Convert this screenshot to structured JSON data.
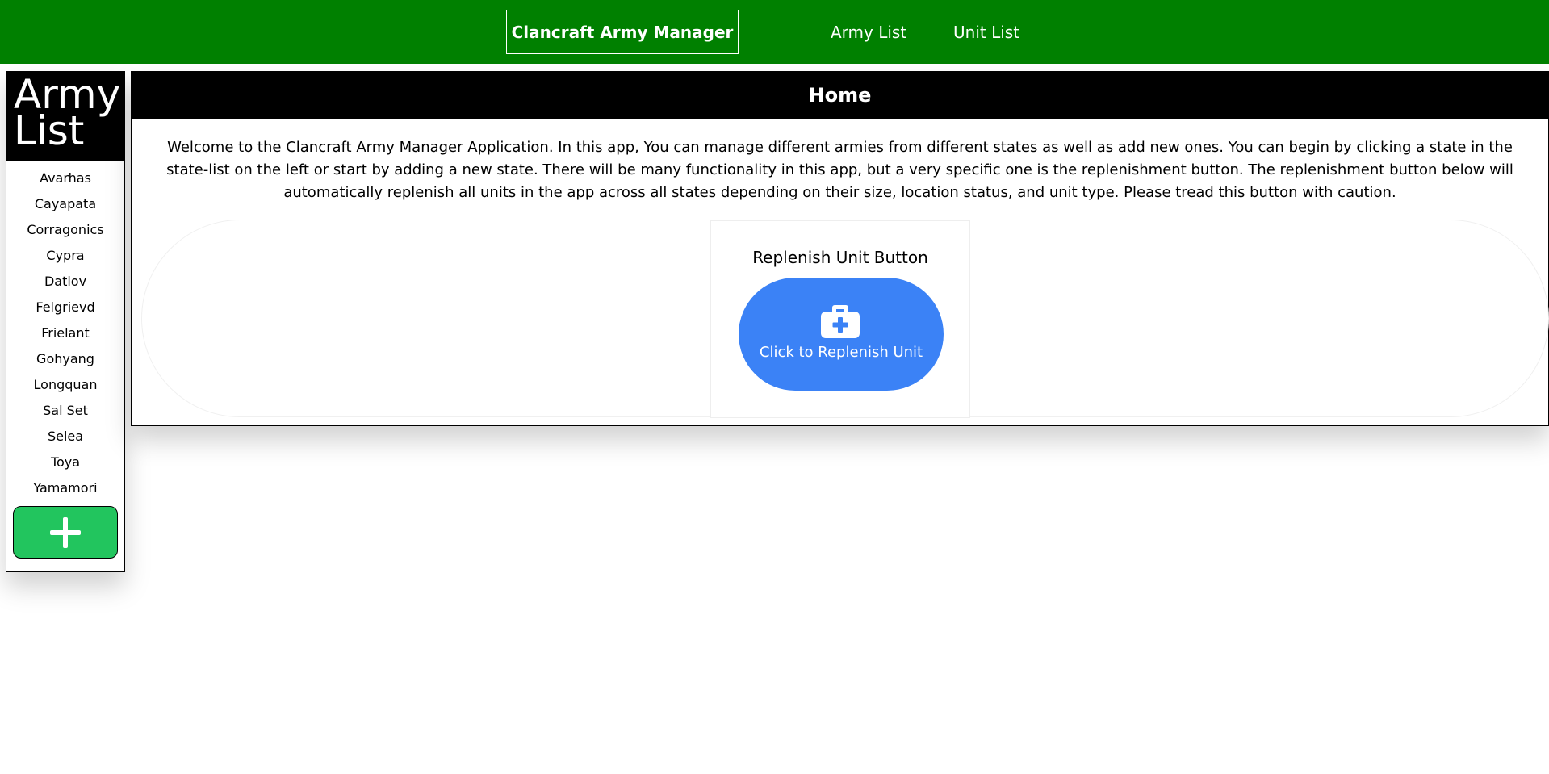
{
  "nav": {
    "brand": "Clancraft Army Manager",
    "links": [
      "Army List",
      "Unit List"
    ]
  },
  "sidebar": {
    "title_line1": "Army",
    "title_line2": "List",
    "states": [
      "Avarhas",
      "Cayapata",
      "Corragonics",
      "Cypra",
      "Datlov",
      "Felgrievd",
      "Frielant",
      "Gohyang",
      "Longquan",
      "Sal Set",
      "Selea",
      "Toya",
      "Yamamori"
    ],
    "add_icon": "plus-icon"
  },
  "main": {
    "header": "Home",
    "welcome": "Welcome to the Clancraft Army Manager Application. In this app, You can manage different armies from different states as well as add new ones. You can begin by clicking a state in the state-list on the left or start by adding a new state. There will be many functionality in this app, but a very specific one is the replenishment button. The replenishment button below will automatically replenish all units in the app across all states depending on their size, location status, and unit type. Please tread this button with caution.",
    "card_title": "Replenish Unit Button",
    "button_label": "Click to Replenish Unit",
    "button_icon": "medkit-icon"
  },
  "colors": {
    "nav_bg": "#008000",
    "add_button": "#22c55e",
    "replenish_button": "#3b82f6"
  }
}
